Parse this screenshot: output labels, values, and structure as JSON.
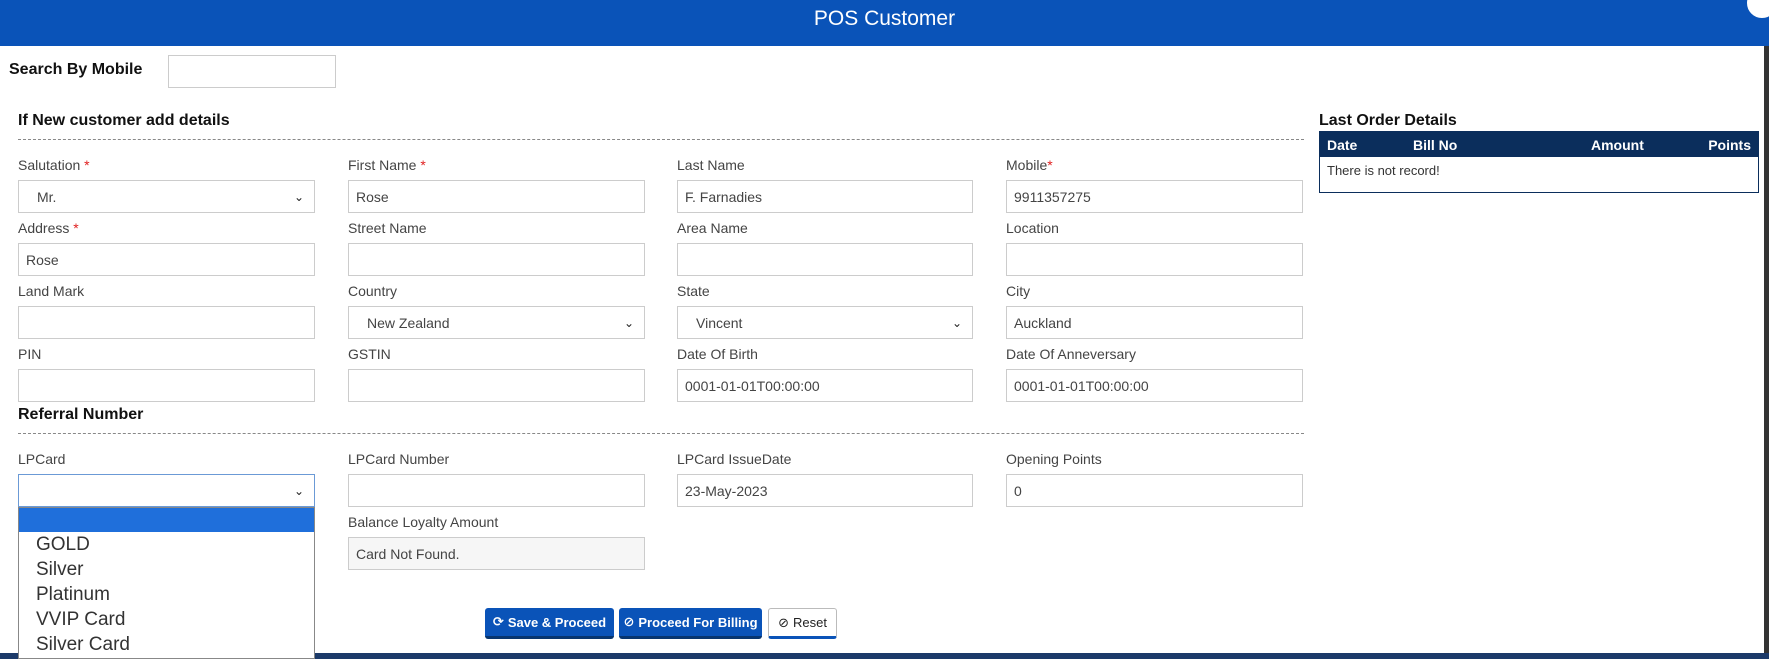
{
  "window": {
    "title": "POS Customer"
  },
  "search": {
    "label": "Search By Mobile",
    "value": ""
  },
  "new_customer": {
    "heading": "If New customer add details",
    "salutation": {
      "label": "Salutation",
      "required": "*",
      "value": "Mr."
    },
    "first_name": {
      "label": "First Name",
      "required": "*",
      "value": "Rose"
    },
    "last_name": {
      "label": "Last Name",
      "value": "F. Farnadies"
    },
    "mobile": {
      "label": "Mobile",
      "required": "*",
      "value": "9911357275"
    },
    "address": {
      "label": "Address",
      "required": "*",
      "value": "Rose"
    },
    "street_name": {
      "label": "Street Name",
      "value": ""
    },
    "area_name": {
      "label": "Area Name",
      "value": ""
    },
    "location": {
      "label": "Location",
      "value": ""
    },
    "land_mark": {
      "label": "Land Mark",
      "value": ""
    },
    "country": {
      "label": "Country",
      "value": "New Zealand"
    },
    "state": {
      "label": "State",
      "value": "Vincent"
    },
    "city": {
      "label": "City",
      "value": "Auckland"
    },
    "pin": {
      "label": "PIN",
      "value": ""
    },
    "gstin": {
      "label": "GSTIN",
      "value": ""
    },
    "dob": {
      "label": "Date Of Birth",
      "value": "0001-01-01T00:00:00"
    },
    "anniversary": {
      "label": "Date Of Anneversary",
      "value": "0001-01-01T00:00:00"
    }
  },
  "referral": {
    "heading": "Referral Number",
    "lpcard": {
      "label": "LPCard",
      "value": "",
      "options": [
        "",
        "GOLD",
        "Silver",
        "Platinum",
        "VVIP Card",
        "Silver Card"
      ]
    },
    "lpcard_number": {
      "label": "LPCard Number",
      "value": ""
    },
    "lpcard_issue_date": {
      "label": "LPCard IssueDate",
      "value": "23-May-2023"
    },
    "opening_points": {
      "label": "Opening Points",
      "value": "0"
    },
    "balance_loyalty": {
      "label": "Balance Loyalty Amount",
      "value": "Card Not Found."
    }
  },
  "last_order": {
    "heading": "Last Order Details",
    "columns": [
      "Date",
      "Bill No",
      "Amount",
      "Points"
    ],
    "empty_text": "There is not record!"
  },
  "buttons": {
    "save_proceed": "Save & Proceed",
    "proceed_billing": "Proceed For Billing",
    "reset": "Reset"
  },
  "colors": {
    "header": "#0a53b8",
    "table_header": "#0b2e5c",
    "required": "#e02020",
    "dropdown_selected": "#1f6fdb"
  },
  "icons": {
    "save": "refresh-icon",
    "billing": "ban-icon",
    "reset": "ban-icon",
    "select": "chevron-down-icon"
  }
}
